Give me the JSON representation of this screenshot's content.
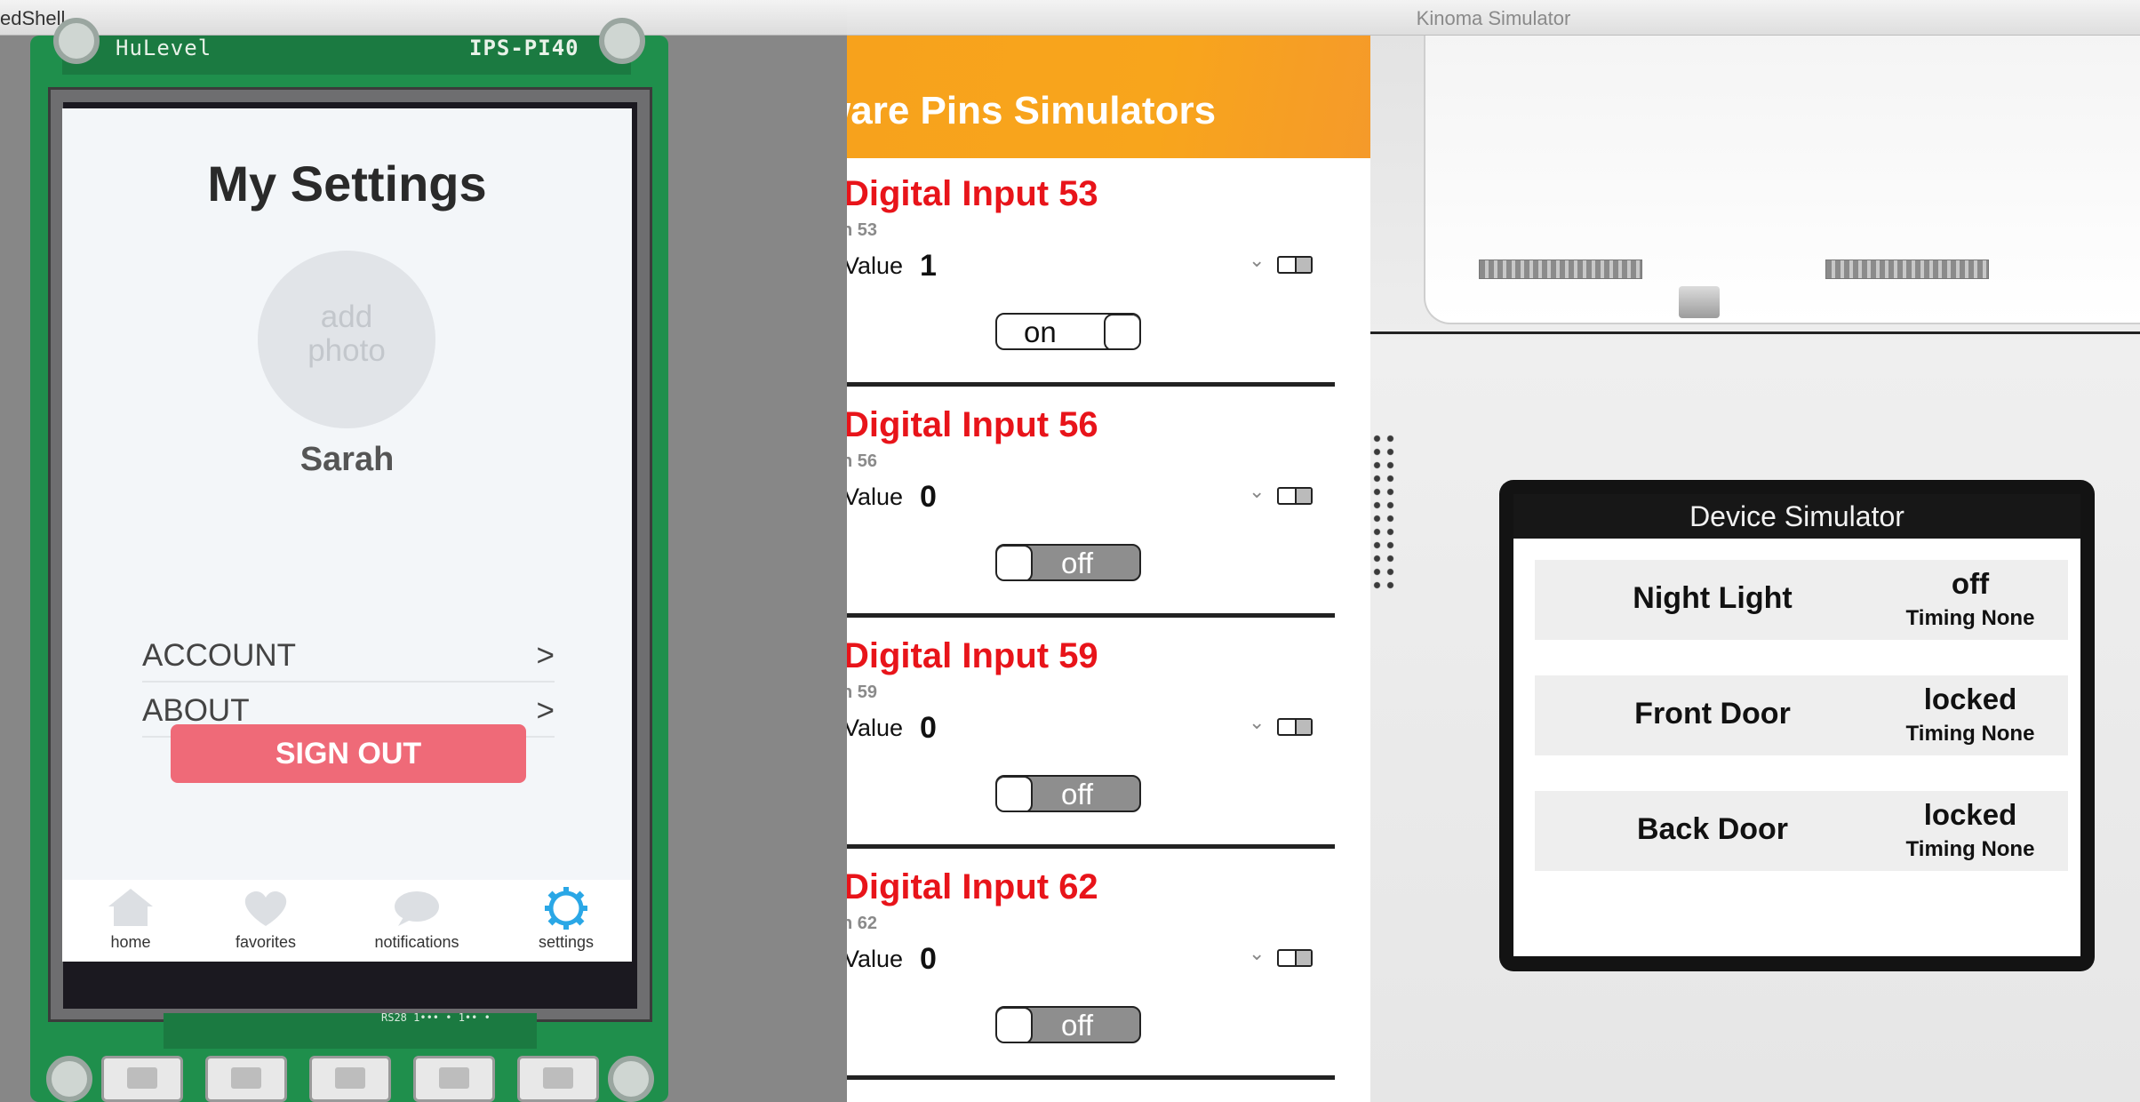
{
  "left_window": {
    "title": "edShell",
    "board": {
      "silk_left": "HuLevel",
      "silk_right": "IPS-PI40",
      "silk_bottom": "RS28 1••• • 1•• •"
    },
    "app": {
      "title": "My Settings",
      "avatar_text": "add photo",
      "user_name": "Sarah",
      "menu": [
        {
          "label": "ACCOUNT",
          "chevron": ">"
        },
        {
          "label": "ABOUT",
          "chevron": ">"
        }
      ],
      "sign_out_label": "SIGN OUT",
      "tabs": [
        {
          "label": "home",
          "icon": "home-icon",
          "active": false
        },
        {
          "label": "favorites",
          "icon": "heart-icon",
          "active": false
        },
        {
          "label": "notifications",
          "icon": "chat-bubble-icon",
          "active": false
        },
        {
          "label": "settings",
          "icon": "gear-icon",
          "active": true
        }
      ],
      "accent_color": "#2aa7e6",
      "signout_color": "#ef6a78"
    }
  },
  "right_window": {
    "title": "Kinoma Simulator",
    "pins_panel": {
      "header": "ware Pins Simulators",
      "pins": [
        {
          "name": "Digital Input 53",
          "sub": "n 53",
          "value_label": "Value",
          "value": "1",
          "switch": "on"
        },
        {
          "name": "Digital Input 56",
          "sub": "n 56",
          "value_label": "Value",
          "value": "0",
          "switch": "off"
        },
        {
          "name": "Digital Input 59",
          "sub": "n 59",
          "value_label": "Value",
          "value": "0",
          "switch": "off"
        },
        {
          "name": "Digital Input 62",
          "sub": "n 62",
          "value_label": "Value",
          "value": "0",
          "switch": "off"
        }
      ]
    },
    "device_simulator": {
      "title": "Device Simulator",
      "devices": [
        {
          "name": "Night Light",
          "state": "off",
          "timing": "Timing None"
        },
        {
          "name": "Front Door",
          "state": "locked",
          "timing": "Timing None"
        },
        {
          "name": "Back Door",
          "state": "locked",
          "timing": "Timing None"
        }
      ]
    }
  }
}
